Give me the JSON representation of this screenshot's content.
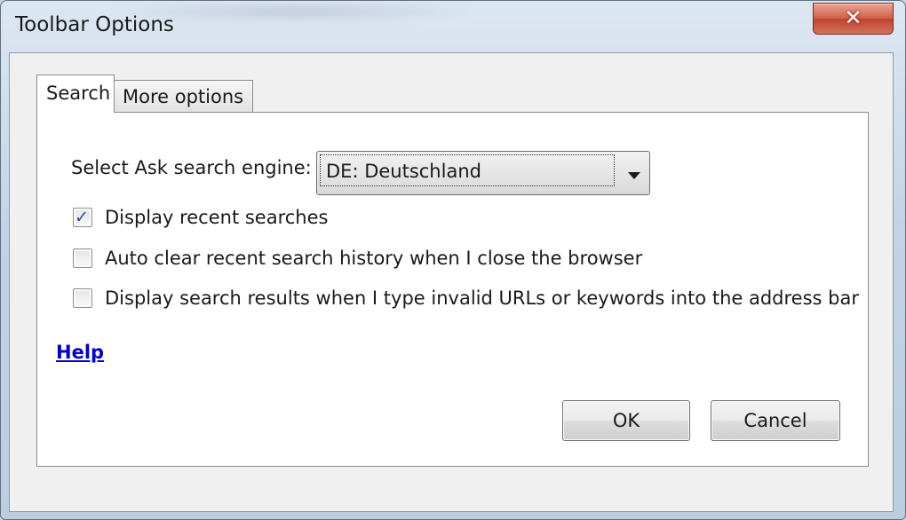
{
  "window": {
    "title": "Toolbar Options",
    "close_label": "✕"
  },
  "tabs": [
    {
      "label": "Search",
      "active": true
    },
    {
      "label": "More options",
      "active": false
    }
  ],
  "search_tab": {
    "engine_label": "Select Ask search engine:",
    "engine_value": "DE: Deutschland",
    "options": [
      {
        "label": "Display recent searches",
        "checked": true
      },
      {
        "label": "Auto clear recent search history when I close the browser",
        "checked": false
      },
      {
        "label": "Display search results when I type invalid URLs or keywords into the address bar",
        "checked": false
      }
    ],
    "help_link": "Help"
  },
  "buttons": {
    "ok": "OK",
    "cancel": "Cancel"
  },
  "colors": {
    "close_button": "#c0432b",
    "link": "#0000cc",
    "check": "#2b4a86"
  }
}
